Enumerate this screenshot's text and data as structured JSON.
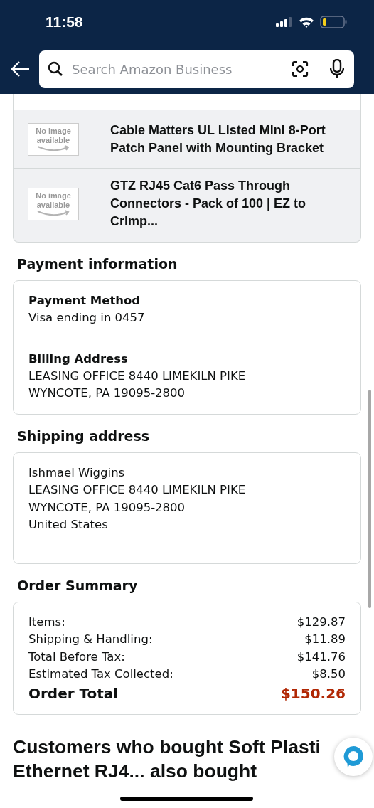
{
  "status_bar": {
    "time": "11:58"
  },
  "search": {
    "placeholder": "Search Amazon Business"
  },
  "products": [
    {
      "image_text": "No image available",
      "title": "Cable Matters UL Listed Mini 8-Port Patch Panel with Mounting Bracket"
    },
    {
      "image_text": "No image available",
      "title": "GTZ RJ45 Cat6 Pass Through Connectors - Pack of 100 | EZ to Crimp..."
    }
  ],
  "payment": {
    "heading": "Payment information",
    "sections": [
      {
        "label": "Payment Method",
        "lines": [
          "Visa ending in 0457"
        ]
      },
      {
        "label": "Billing Address",
        "lines": [
          "LEASING OFFICE 8440 LIMEKILN PIKE",
          "WYNCOTE, PA 19095-2800"
        ]
      }
    ]
  },
  "shipping": {
    "heading": "Shipping address",
    "lines": [
      "Ishmael Wiggins",
      "LEASING OFFICE 8440 LIMEKILN PIKE",
      "WYNCOTE, PA 19095-2800",
      "United States"
    ]
  },
  "summary": {
    "heading": "Order Summary",
    "rows": [
      {
        "label": "Items:",
        "value": "$129.87"
      },
      {
        "label": "Shipping & Handling:",
        "value": "$11.89"
      },
      {
        "label": "Total Before Tax:",
        "value": "$141.76"
      },
      {
        "label": "Estimated Tax Collected:",
        "value": "$8.50"
      }
    ],
    "total": {
      "label": "Order Total",
      "value": "$150.26"
    }
  },
  "also_bought": {
    "heading_lines": [
      "Customers who bought Soft Plasti",
      "Ethernet RJ4... also bought"
    ]
  }
}
